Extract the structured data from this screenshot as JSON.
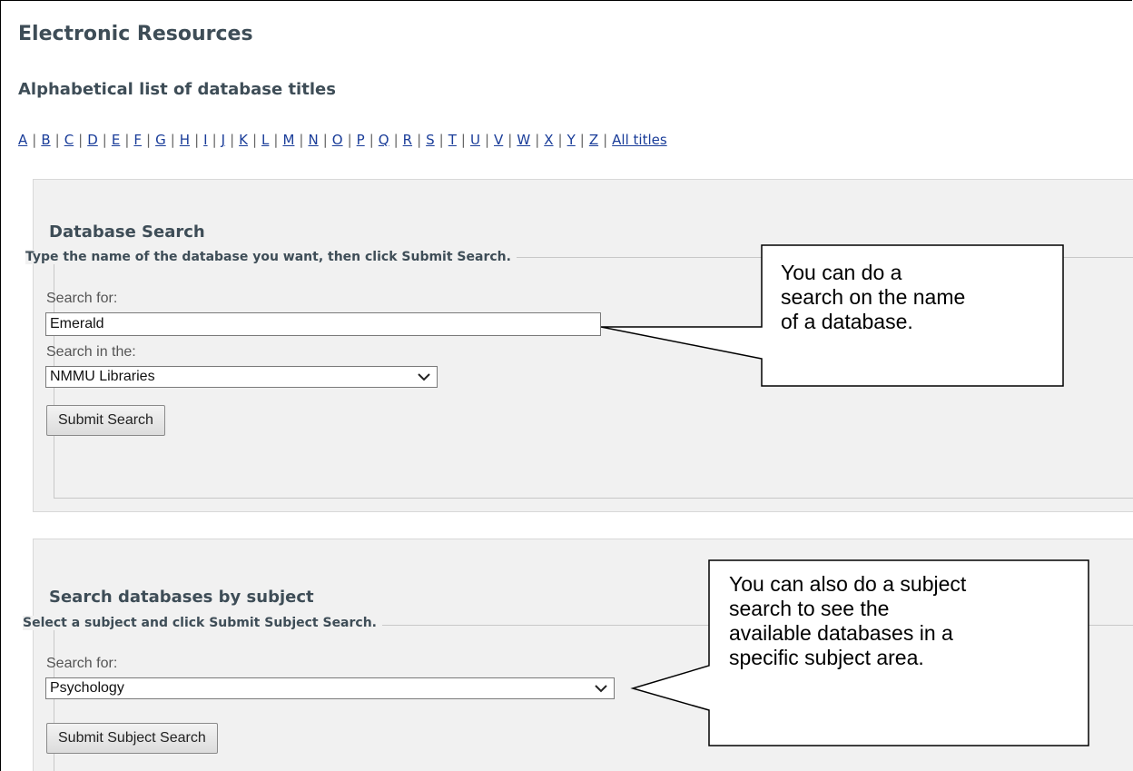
{
  "page": {
    "title": "Electronic Resources",
    "list_title": "Alphabetical list of database titles"
  },
  "alpha_nav": {
    "letters": [
      "A",
      "B",
      "C",
      "D",
      "E",
      "F",
      "G",
      "H",
      "I",
      "J",
      "K",
      "L",
      "M",
      "N",
      "O",
      "P",
      "Q",
      "R",
      "S",
      "T",
      "U",
      "V",
      "W",
      "X",
      "Y",
      "Z"
    ],
    "all_titles": "All titles"
  },
  "db_search": {
    "title": "Database Search",
    "instruction": "Type the name of the database you want, then click Submit Search.",
    "search_label": "Search for:",
    "search_value": "Emerald",
    "scope_label": "Search in the:",
    "scope_value": "NMMU Libraries",
    "submit_label": "Submit Search"
  },
  "subject_search": {
    "title": "Search databases by subject",
    "instruction": "Select a subject and click Submit Subject Search.",
    "search_label": "Search for:",
    "subject_value": "Psychology",
    "submit_label": "Submit Subject Search"
  },
  "callouts": {
    "name_search": [
      "You can do a",
      "search on the name",
      "of a database."
    ],
    "subject_search": [
      "You can also do a subject",
      "search to see the",
      "available databases in a",
      "specific subject area."
    ]
  }
}
